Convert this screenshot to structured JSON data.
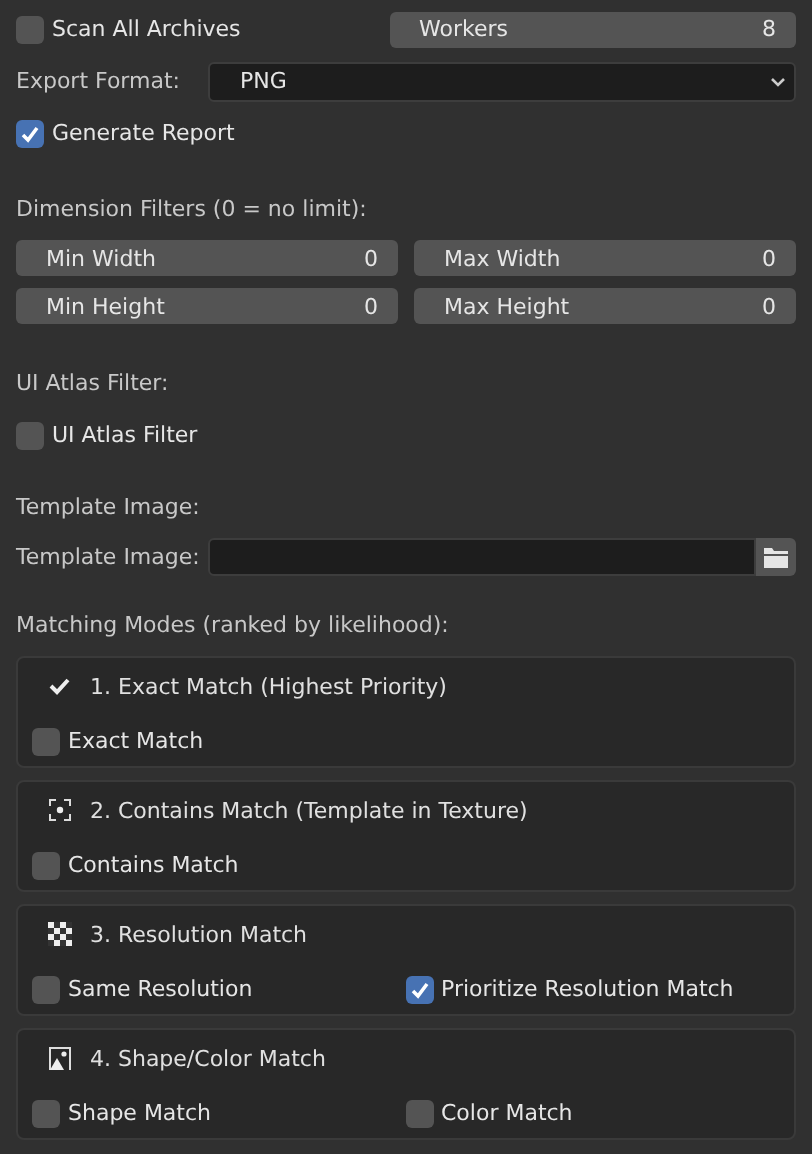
{
  "scan_all_archives": {
    "label": "Scan All Archives",
    "checked": false
  },
  "workers": {
    "label": "Workers",
    "value": "8"
  },
  "export_format": {
    "label": "Export Format:",
    "value": "PNG"
  },
  "generate_report": {
    "label": "Generate Report",
    "checked": true
  },
  "dimension_filters": {
    "heading": "Dimension Filters (0 = no limit):",
    "fields": [
      {
        "label": "Min Width",
        "value": "0"
      },
      {
        "label": "Max Width",
        "value": "0"
      },
      {
        "label": "Min Height",
        "value": "0"
      },
      {
        "label": "Max Height",
        "value": "0"
      }
    ]
  },
  "ui_atlas": {
    "heading": "UI Atlas Filter:",
    "checkbox": {
      "label": "UI Atlas Filter",
      "checked": false
    }
  },
  "template_image": {
    "heading": "Template Image:",
    "label": "Template Image:"
  },
  "matching_modes": {
    "heading": "Matching Modes (ranked by likelihood):",
    "panels": [
      {
        "title": "1. Exact Match (Highest Priority)",
        "options": [
          {
            "label": "Exact Match",
            "checked": false
          }
        ]
      },
      {
        "title": "2. Contains Match (Template in Texture)",
        "options": [
          {
            "label": "Contains Match",
            "checked": false
          }
        ]
      },
      {
        "title": "3. Resolution Match",
        "options": [
          {
            "label": "Same Resolution",
            "checked": false
          },
          {
            "label": "Prioritize Resolution Match",
            "checked": true
          }
        ]
      },
      {
        "title": "4. Shape/Color Match",
        "options": [
          {
            "label": "Shape Match",
            "checked": false
          },
          {
            "label": "Color Match",
            "checked": false
          }
        ]
      }
    ]
  }
}
